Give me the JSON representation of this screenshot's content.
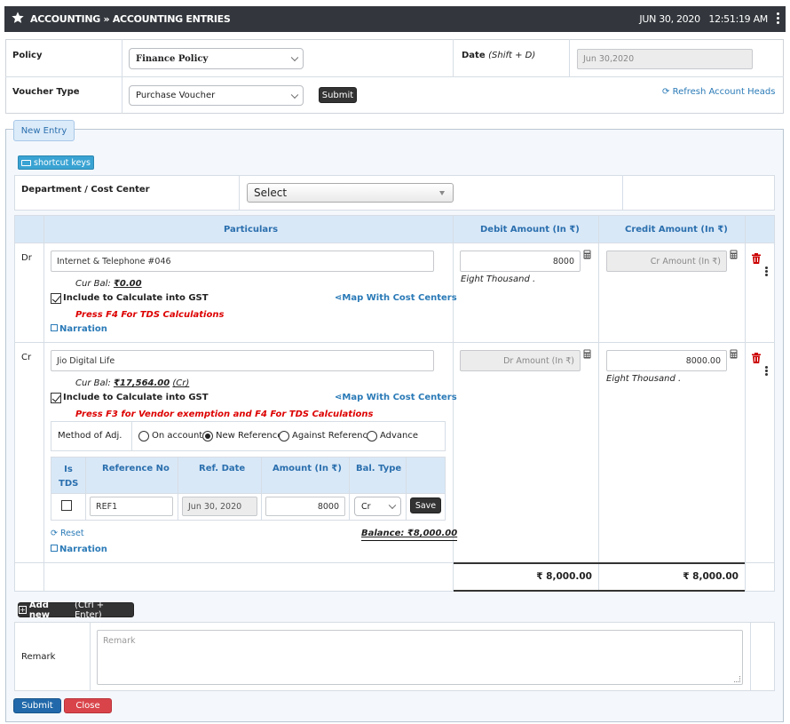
{
  "header": {
    "title": "ACCOUNTING » ACCOUNTING ENTRIES",
    "date": "JUN 30, 2020",
    "time": "12:51:19 AM"
  },
  "form": {
    "policy_label": "Policy",
    "policy_value": "Finance Policy",
    "date_label": "Date",
    "date_hint": "(Shift + D)",
    "date_value": "Jun 30,2020",
    "voucher_label": "Voucher Type",
    "voucher_value": "Purchase Voucher",
    "submit_label": "Submit",
    "refresh_label": "Refresh Account Heads"
  },
  "entry": {
    "tab_label": "New Entry",
    "shortcut_label": "shortcut keys",
    "dept_label": "Department / Cost Center",
    "dept_value": "Select",
    "col_particulars": "Particulars",
    "col_debit": "Debit Amount (In ₹)",
    "col_credit": "Credit Amount (In ₹)"
  },
  "rows": [
    {
      "type": "Dr",
      "account": "Internet & Telephone #046",
      "bal_label": "Cur Bal:",
      "bal_value": "₹0.00",
      "gst_label": "Include to Calculate into GST",
      "map_label": "Map With Cost Centers",
      "hint": "Press F4 For TDS Calculations",
      "narration": "Narration",
      "debit": "8000",
      "debit_words": "Eight Thousand .",
      "credit_placeholder": "Cr Amount (In ₹)"
    },
    {
      "type": "Cr",
      "account": "Jio Digital Life",
      "bal_label": "Cur Bal:",
      "bal_value": "₹17,564.00",
      "bal_suffix": "(Cr)",
      "gst_label": "Include to Calculate into GST",
      "map_label": "Map With Cost Centers",
      "hint": "Press F3 for Vendor exemption and F4 For TDS Calculations",
      "narration": "Narration",
      "debit_placeholder": "Dr Amount (In ₹)",
      "credit": "8000.00",
      "credit_words": "Eight Thousand ."
    }
  ],
  "adjust": {
    "label": "Method of Adj.",
    "options": [
      "On account",
      "New Reference",
      "Against Reference",
      "Advance"
    ],
    "selected": "New Reference"
  },
  "ref_table": {
    "col_tds": "Is TDS",
    "col_ref": "Reference No",
    "col_date": "Ref. Date",
    "col_amount": "Amount (In ₹)",
    "col_bal": "Bal. Type",
    "ref_no": "REF1",
    "ref_date": "Jun 30, 2020",
    "amount": "8000",
    "bal_type": "Cr",
    "save_label": "Save",
    "reset_label": "Reset",
    "balance_text": "Balance: ₹8,000.00"
  },
  "totals": {
    "debit": "₹ 8,000.00",
    "credit": "₹ 8,000.00"
  },
  "footer": {
    "add_new_label": "Add new",
    "add_new_hint": "(Ctrl + Enter)",
    "remark_label": "Remark",
    "remark_placeholder": "Remark",
    "submit_label": "Submit",
    "close_label": "Close"
  }
}
